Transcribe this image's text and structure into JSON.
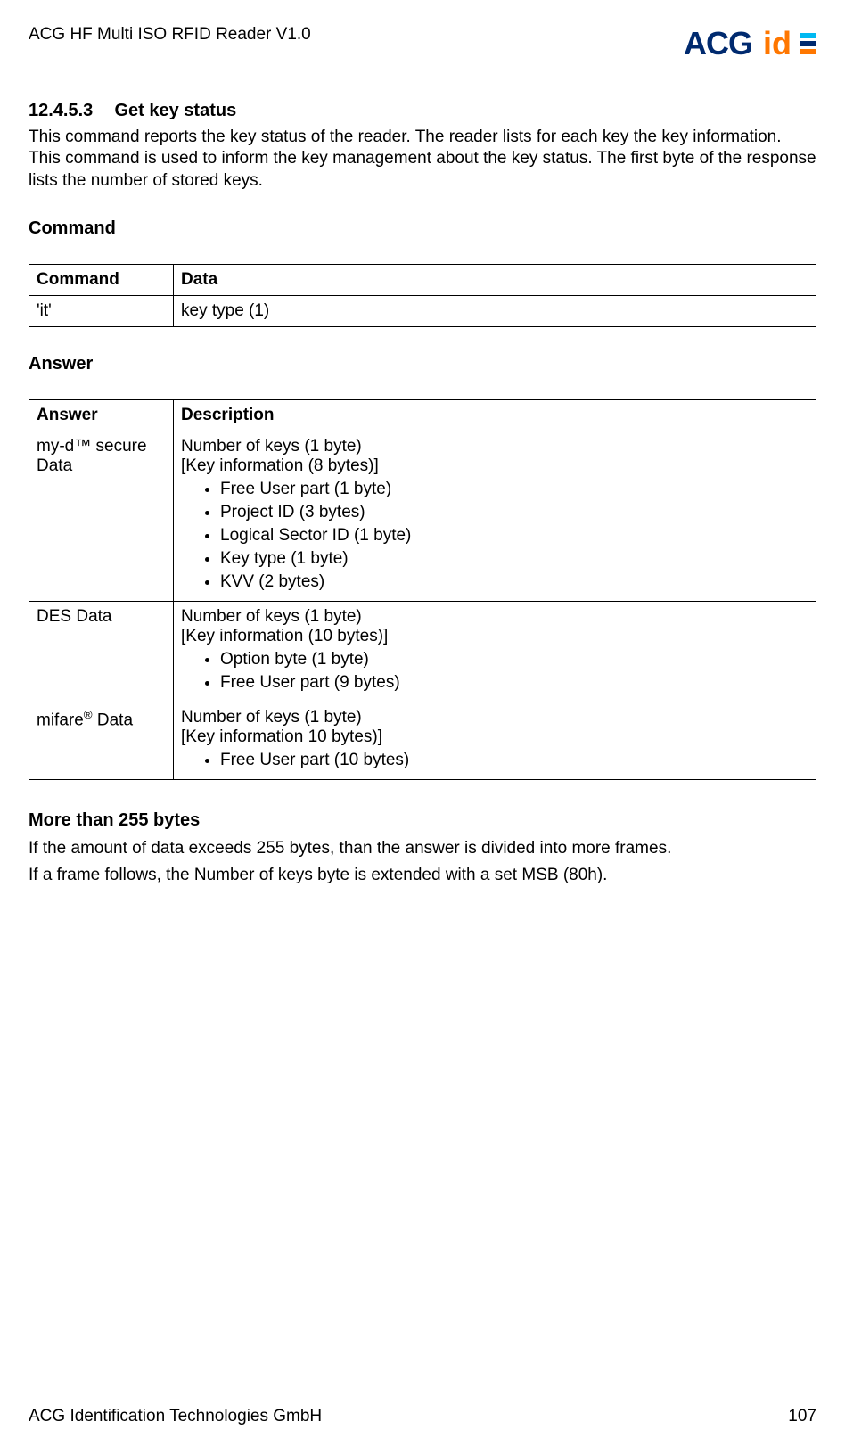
{
  "header": {
    "product": "ACG HF Multi ISO RFID Reader V1.0",
    "logo": {
      "a": "A",
      "c": "C",
      "g": "G",
      "id": "id"
    }
  },
  "section": {
    "number": "12.4.5.3",
    "title": "Get key status",
    "body": "This command reports the key status of the reader. The reader lists for each key the key information. This command is used to inform the key management about the key status. The first byte of the response lists the number of stored keys."
  },
  "command": {
    "heading": "Command",
    "headers": [
      "Command",
      "Data"
    ],
    "rows": [
      {
        "c0": "'it'",
        "c1": "key type (1)"
      }
    ]
  },
  "answer": {
    "heading": "Answer",
    "headers": [
      "Answer",
      "Description"
    ],
    "rows": [
      {
        "c0_pre": "my-d",
        "c0_tm": "™",
        "c0_post": " secure Data",
        "desc_lines": "Number of keys (1 byte)\n[Key information (8 bytes)]",
        "bullets": [
          "Free User part (1 byte)",
          "Project ID (3 bytes)",
          "Logical Sector ID (1 byte)",
          "Key type (1 byte)",
          "KVV (2 bytes)"
        ]
      },
      {
        "c0_pre": "DES Data",
        "c0_tm": "",
        "c0_post": "",
        "desc_lines": "Number of keys (1 byte)\n[Key information (10 bytes)]",
        "bullets": [
          "Option byte (1 byte)",
          "Free User part (9 bytes)"
        ]
      },
      {
        "c0_pre": "mifare",
        "c0_tm": "®",
        "c0_post": " Data",
        "desc_lines": "Number of keys (1 byte)\n[Key information 10 bytes)]",
        "bullets": [
          "Free User part (10 bytes)"
        ]
      }
    ]
  },
  "more": {
    "heading": "More than 255 bytes",
    "p1": "If the amount of data exceeds 255 bytes, than the answer is divided into more frames.",
    "p2": "If a frame follows, the Number of keys byte is extended with a set MSB (80h)."
  },
  "footer": {
    "company": "ACG Identification Technologies GmbH",
    "page": "107"
  }
}
